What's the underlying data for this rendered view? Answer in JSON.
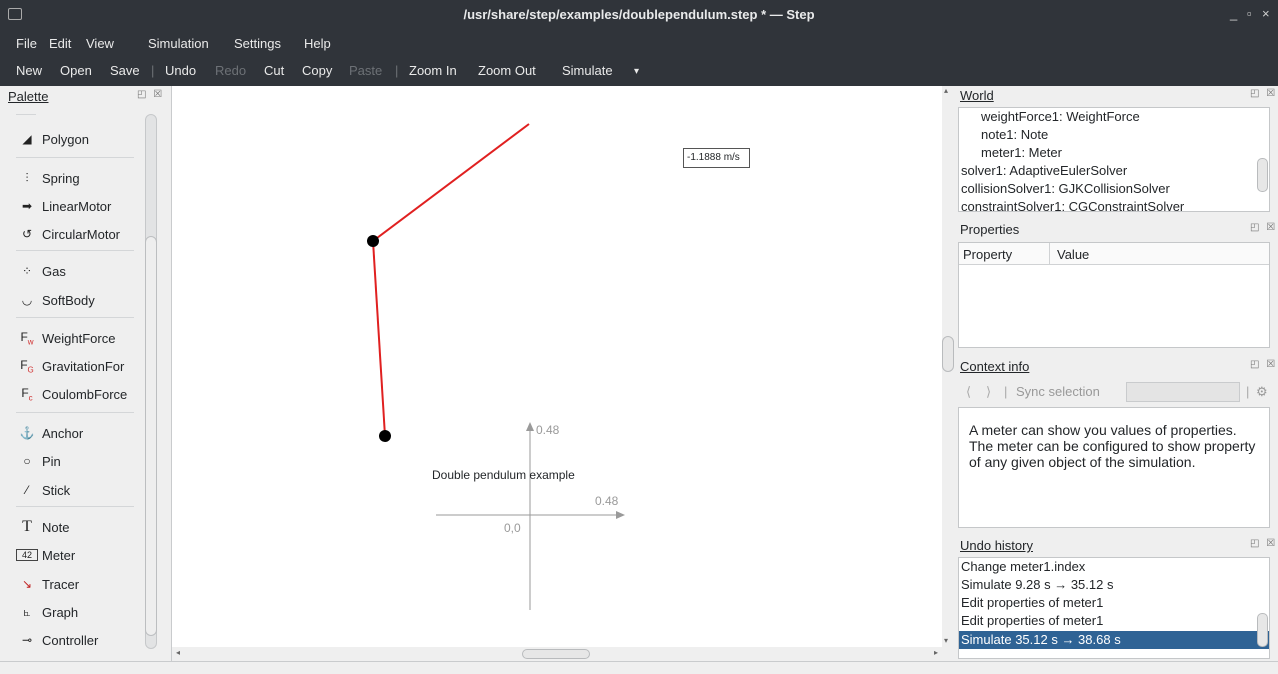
{
  "window": {
    "title": "/usr/share/step/examples/doublependulum.step * — Step",
    "minimize": "_",
    "maximize": "▫",
    "close": "×"
  },
  "menu": {
    "file": "File",
    "edit": "Edit",
    "view": "View",
    "simulation": "Simulation",
    "settings": "Settings",
    "help": "Help"
  },
  "toolbar": {
    "new": "New",
    "open": "Open",
    "save": "Save",
    "sep1": "|",
    "undo": "Undo",
    "redo": "Redo",
    "cut": "Cut",
    "copy": "Copy",
    "paste": "Paste",
    "sep2": "|",
    "zoom_in": "Zoom In",
    "zoom_out": "Zoom Out",
    "simulate": "Simulate",
    "more": "▾"
  },
  "palette": {
    "title": "Palette",
    "items": [
      {
        "label": "Polygon",
        "icon": "polygon-icon"
      },
      {
        "label": "Spring",
        "icon": "spring-icon"
      },
      {
        "label": "LinearMotor",
        "icon": "linear-motor-icon"
      },
      {
        "label": "CircularMotor",
        "icon": "circular-motor-icon"
      },
      {
        "label": "Gas",
        "icon": "gas-icon"
      },
      {
        "label": "SoftBody",
        "icon": "softbody-icon"
      },
      {
        "label": "WeightForce",
        "icon": "weight-force-icon"
      },
      {
        "label": "GravitationFor",
        "icon": "gravitation-force-icon"
      },
      {
        "label": "CoulombForce",
        "icon": "coulomb-force-icon"
      },
      {
        "label": "Anchor",
        "icon": "anchor-icon"
      },
      {
        "label": "Pin",
        "icon": "pin-icon"
      },
      {
        "label": "Stick",
        "icon": "stick-icon"
      },
      {
        "label": "Note",
        "icon": "note-icon"
      },
      {
        "label": "Meter",
        "icon": "meter-icon"
      },
      {
        "label": "Tracer",
        "icon": "tracer-icon"
      },
      {
        "label": "Graph",
        "icon": "graph-icon"
      },
      {
        "label": "Controller",
        "icon": "controller-icon"
      }
    ]
  },
  "canvas": {
    "meter_value": "-1.1888 m/s",
    "note_text": "Double pendulum example",
    "axis_y_label": "0.48",
    "axis_x_label": "0.48",
    "origin_label": "0,0",
    "pendulum_color": "#e02020"
  },
  "world": {
    "title": "World",
    "items": [
      "weightForce1: WeightForce",
      "note1: Note",
      "meter1: Meter",
      "solver1: AdaptiveEulerSolver",
      "collisionSolver1: GJKCollisionSolver",
      "constraintSolver1: CGConstraintSolver"
    ]
  },
  "properties": {
    "title": "Properties",
    "col_property": "Property",
    "col_value": "Value"
  },
  "context_info": {
    "title": "Context info",
    "sync_selection": "Sync selection",
    "text": "A meter can show you values of properties. The meter can be configured to show property of any given object of the simulation."
  },
  "undo_history": {
    "title": "Undo history",
    "items": [
      "Change meter1.index",
      "Simulate 9.28 s → 35.12 s",
      "Edit properties of meter1",
      "Edit properties of meter1",
      "Simulate 35.12 s → 38.68 s"
    ],
    "selected_index": 4,
    "selected_color": "#3daee9"
  }
}
